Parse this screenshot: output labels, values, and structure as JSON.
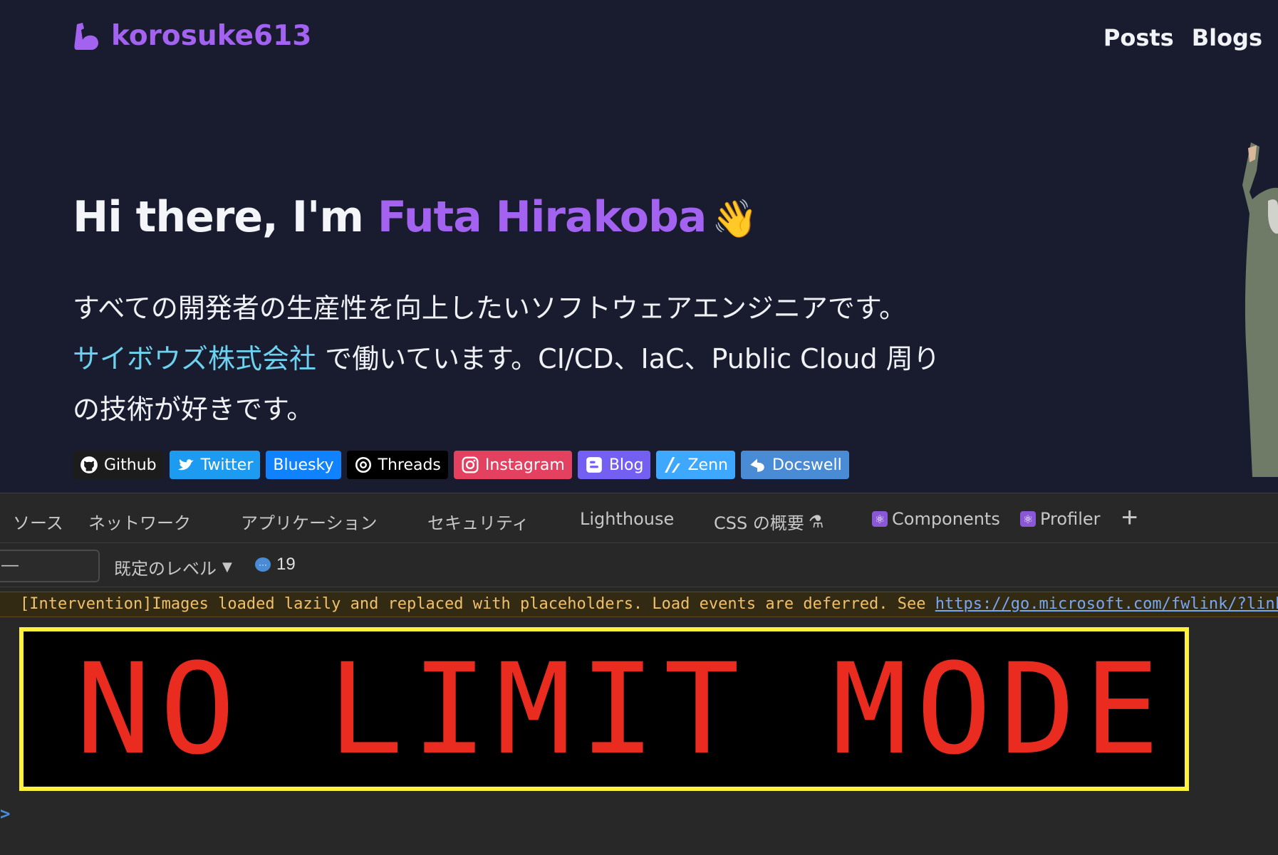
{
  "site": {
    "brand": "korosuke613",
    "nav": [
      "Posts",
      "Blogs"
    ],
    "hero": {
      "prefix": "Hi there, I'm ",
      "name": "Futa Hirakoba",
      "emoji": "👋"
    },
    "bio": {
      "line1": "すべての開発者の生産性を向上したいソフトウェアエンジニアです。",
      "company": "サイボウズ株式会社",
      "line2": " で働いています。CI/CD、IaC、Public Cloud 周りの技術が好きです。"
    },
    "badges": [
      {
        "label": "Github",
        "icon": "github-icon",
        "color": "#1c1c1c"
      },
      {
        "label": "Twitter",
        "icon": "twitter-icon",
        "color": "#1d9bf0"
      },
      {
        "label": "Bluesky",
        "icon": "",
        "color": "#1182fe"
      },
      {
        "label": "Threads",
        "icon": "threads-icon",
        "color": "#000000"
      },
      {
        "label": "Instagram",
        "icon": "instagram-icon",
        "color": "#e4405f"
      },
      {
        "label": "Blog",
        "icon": "blogger-icon",
        "color": "#7360f2"
      },
      {
        "label": "Zenn",
        "icon": "zenn-icon",
        "color": "#3ea8ff"
      },
      {
        "label": "Docswell",
        "icon": "docswell-icon",
        "color": "#4a8bd6"
      }
    ]
  },
  "devtools": {
    "tabs": [
      "ソース",
      "ネットワーク",
      "アプリケーション",
      "セキュリティ",
      "Lighthouse",
      "CSS の概要",
      "Components",
      "Profiler"
    ],
    "filter_value": "—",
    "level_label": "既定のレベル",
    "message_count": "19",
    "warning": {
      "text": "[Intervention]Images loaded lazily and replaced with placeholders. Load events are deferred. See ",
      "link": "https://go.microsoft.com/fwlink/?link"
    },
    "banner": "NO LIMIT MODE",
    "prompt": ">"
  }
}
